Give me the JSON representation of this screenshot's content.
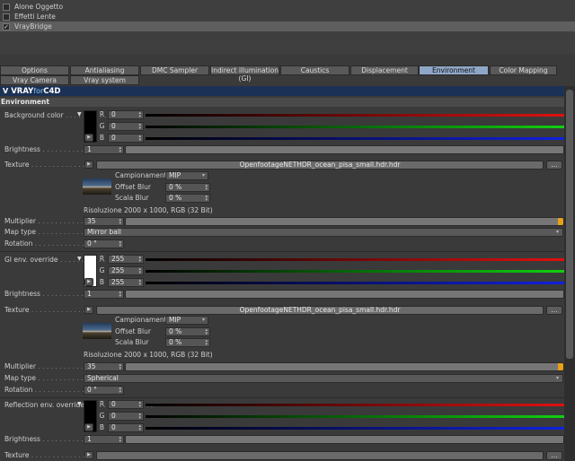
{
  "plugins": [
    {
      "label": "Alone Oggetto",
      "checked": false
    },
    {
      "label": "Effetti Lente",
      "checked": false
    },
    {
      "label": "VrayBridge",
      "checked": true
    }
  ],
  "check_mark": "✓",
  "tabs_row1": [
    "Options",
    "Antialiasing",
    "DMC Sampler",
    "Indirect illumination (GI)",
    "Caustics",
    "Displacement",
    "Environment",
    "Color Mapping"
  ],
  "tabs_row2": [
    "Vray Camera",
    "Vray system"
  ],
  "active_tab": "Environment",
  "logo": {
    "icon": "V",
    "vray": "VRAY",
    "for": "for",
    "c4d": "C4D"
  },
  "section_title": "Environment",
  "leader": ". . . . . . . . . . . . . . . .",
  "channels": {
    "r": "R",
    "g": "G",
    "b": "B"
  },
  "texture_more": "...",
  "sub_labels": {
    "campionamento": "Campionamento",
    "offset_blur": "Offset Blur",
    "scala_blur": "Scala Blur"
  },
  "blocks": {
    "background": {
      "color_label": "Background color",
      "swatch_color": "#000000",
      "r": "0",
      "g": "0",
      "b": "0",
      "brightness_label": "Brightness",
      "brightness": "1",
      "texture_label": "Texture",
      "texture_file": "OpenfootageNETHDR_ocean_pisa_small.hdr.hdr",
      "campionamento": "MIP",
      "offset_blur": "0 %",
      "scala_blur": "0 %",
      "resolution": "Risoluzione 2000 x 1000, RGB (32 Bit)",
      "multiplier_label": "Multiplier",
      "multiplier": "35",
      "map_type_label": "Map type",
      "map_type": "Mirror ball",
      "rotation_label": "Rotation",
      "rotation": "0 °"
    },
    "gi": {
      "color_label": "GI env. override",
      "swatch_color": "#ffffff",
      "r": "255",
      "g": "255",
      "b": "255",
      "brightness_label": "Brightness",
      "brightness": "1",
      "texture_label": "Texture",
      "texture_file": "OpenfootageNETHDR_ocean_pisa_small.hdr.hdr",
      "campionamento": "MIP",
      "offset_blur": "0 %",
      "scala_blur": "0 %",
      "resolution": "Risoluzione 2000 x 1000, RGB (32 Bit)",
      "multiplier_label": "Multiplier",
      "multiplier": "35",
      "map_type_label": "Map type",
      "map_type": "Spherical",
      "rotation_label": "Rotation",
      "rotation": "0 °"
    },
    "reflection": {
      "color_label": "Reflection env. override",
      "swatch_color": "#000000",
      "r": "0",
      "g": "0",
      "b": "0",
      "brightness_label": "Brightness",
      "brightness": "1",
      "texture_label": "Texture"
    }
  },
  "colors": {
    "accent_tab": "#8fa7c7",
    "logo_bar": "#1c3156",
    "slider_fill": "#e8a018"
  }
}
